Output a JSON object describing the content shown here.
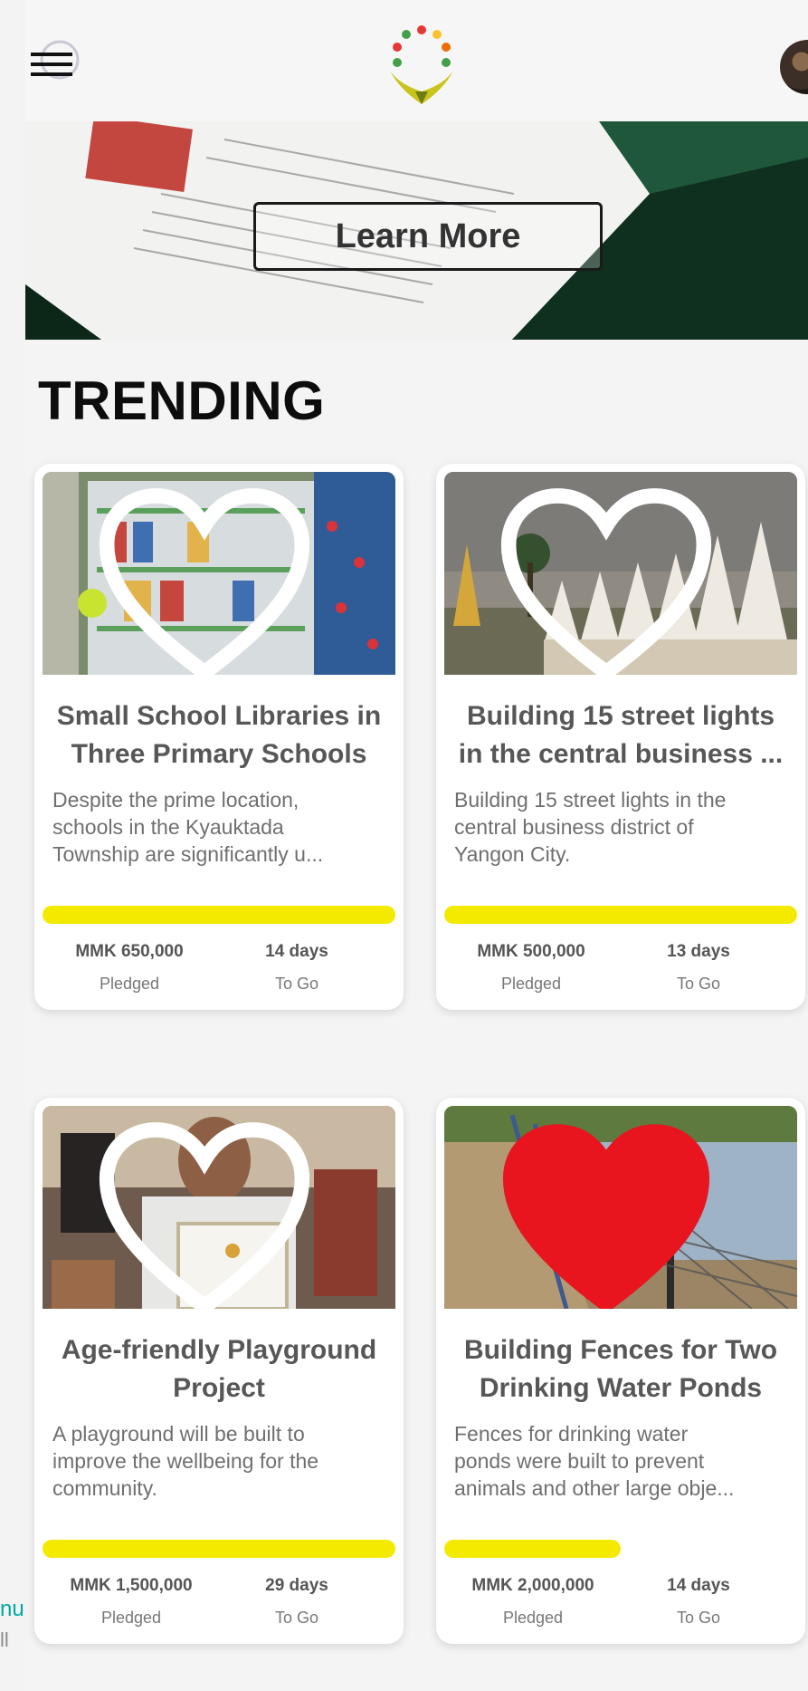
{
  "header": {
    "menu_icon": "hamburger-icon",
    "logo_icon": "heart-ring-logo",
    "avatar_icon": "user-avatar"
  },
  "hero": {
    "button_label": "Learn More"
  },
  "section": {
    "title": "TRENDING"
  },
  "cards": [
    {
      "title": "Small School Libraries in\nThree Primary Schools",
      "description": "Despite the prime location,\nschools in the Kyauktada\nTownship are significantly u...",
      "amount": "MMK 650,000",
      "amount_label": "Pledged",
      "days": "14 days",
      "days_label": "To Go",
      "progress": 1.0,
      "favorited": false
    },
    {
      "title": "Building 15 street lights\nin the central business ...",
      "description": "Building 15 street lights in the\ncentral business district of\nYangon City.",
      "amount": "MMK 500,000",
      "amount_label": "Pledged",
      "days": "13 days",
      "days_label": "To Go",
      "progress": 1.0,
      "favorited": false
    },
    {
      "title": "Age-friendly Playground\nProject",
      "description": "A playground will be built to\nimprove the wellbeing for the\ncommunity.",
      "amount": "MMK 1,500,000",
      "amount_label": "Pledged",
      "days": "29 days",
      "days_label": "To Go",
      "progress": 1.0,
      "favorited": false
    },
    {
      "title": "Building Fences for Two\nDrinking Water Ponds",
      "description": "Fences for drinking water\nponds were built to prevent\nanimals and other large obje...",
      "amount": "MMK 2,000,000",
      "amount_label": "Pledged",
      "days": "14 days",
      "days_label": "To Go",
      "progress": 0.5,
      "favorited": true
    }
  ],
  "left_edge": {
    "line1": "nu",
    "line2": "ll"
  },
  "colors": {
    "progress": "#f4ea00",
    "heart_filled": "#e8141e",
    "accent_teal": "#00a9a5"
  }
}
